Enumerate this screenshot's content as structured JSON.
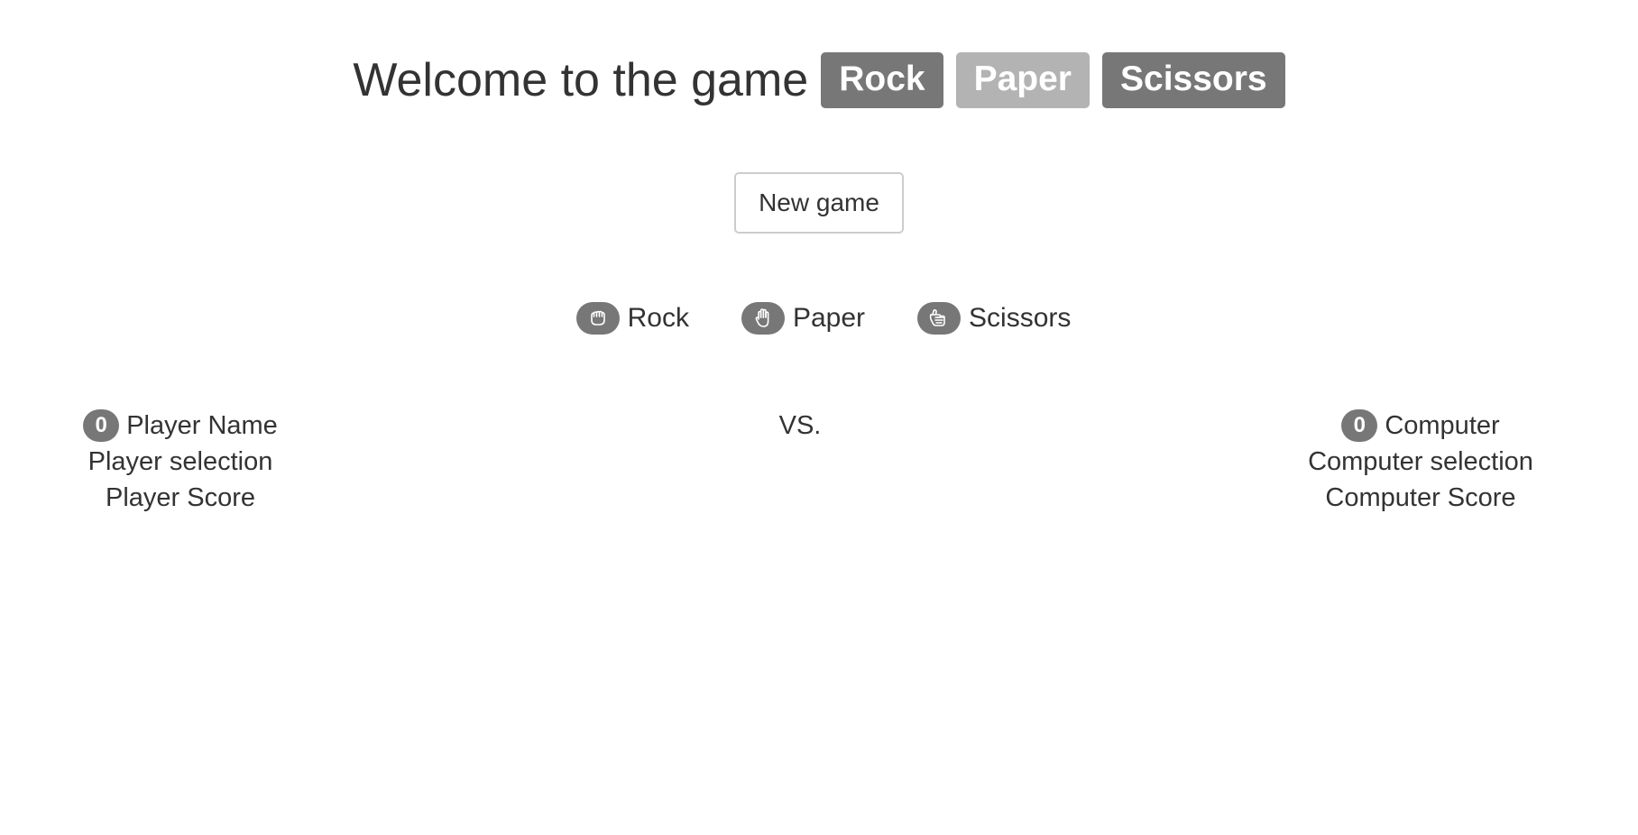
{
  "header": {
    "title": "Welcome to the game",
    "badges": {
      "rock": "Rock",
      "paper": "Paper",
      "scissors": "Scissors"
    }
  },
  "controls": {
    "new_game_label": "New game"
  },
  "choices": {
    "rock": {
      "label": "Rock",
      "icon": "fist-icon"
    },
    "paper": {
      "label": "Paper",
      "icon": "open-hand-icon"
    },
    "scissors": {
      "label": "Scissors",
      "icon": "scissors-hand-icon"
    }
  },
  "player": {
    "score": "0",
    "name": "Player Name",
    "selection": "Player selection",
    "score_label": "Player Score"
  },
  "versus": "VS.",
  "computer": {
    "score": "0",
    "name": "Computer",
    "selection": "Computer selection",
    "score_label": "Computer Score"
  },
  "colors": {
    "badge_dark": "#777777",
    "badge_light": "#b3b3b3",
    "text": "#333333"
  }
}
